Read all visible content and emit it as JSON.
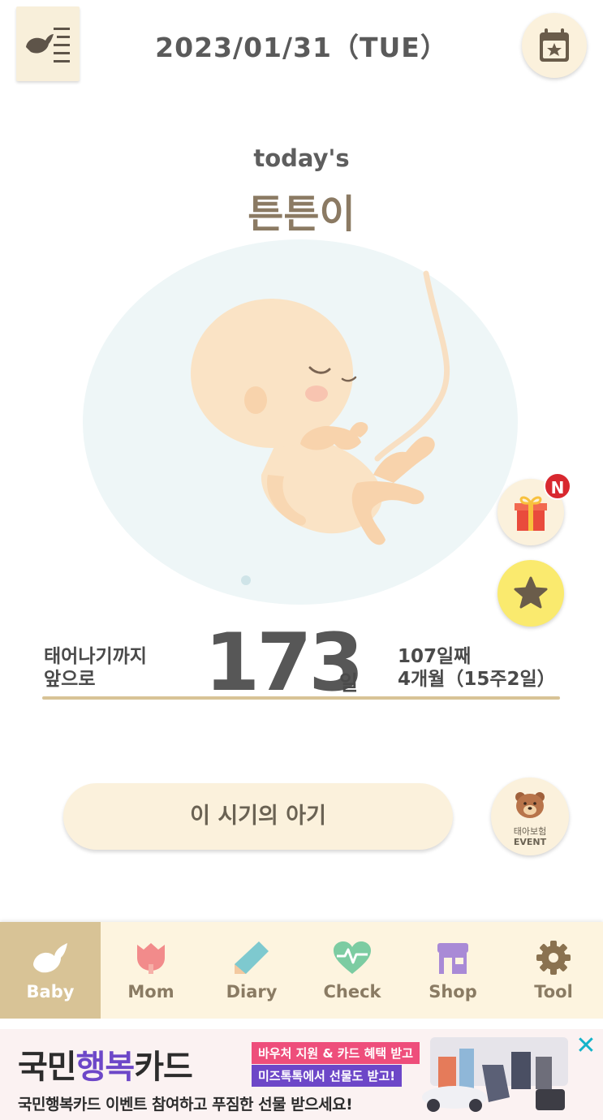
{
  "header": {
    "date": "2023/01/31（TUE）"
  },
  "hero": {
    "subtitle": "today's",
    "baby_name": "튼튼이"
  },
  "countdown": {
    "left_line1": "태어나기까지",
    "left_line2": "앞으로",
    "days": "173",
    "unit": "일",
    "right_line1": "107일째",
    "right_line2": "4개월（15주2일）"
  },
  "badges": {
    "new": "N"
  },
  "buttons": {
    "baby_period": "이 시기의 아기",
    "event_line1": "태아보험",
    "event_line2": "EVENT"
  },
  "nav": {
    "items": [
      {
        "label": "Baby",
        "icon": "baby-bird-icon",
        "active": true
      },
      {
        "label": "Mom",
        "icon": "tulip-icon",
        "active": false
      },
      {
        "label": "Diary",
        "icon": "pencil-icon",
        "active": false
      },
      {
        "label": "Check",
        "icon": "heart-pulse-icon",
        "active": false
      },
      {
        "label": "Shop",
        "icon": "shop-icon",
        "active": false
      },
      {
        "label": "Tool",
        "icon": "gear-icon",
        "active": false
      }
    ]
  },
  "ad": {
    "headline_part1": "국민",
    "headline_part2": "행복",
    "headline_part3": "카드",
    "tag1": "바우처 지원 & 카드 혜택 받고",
    "tag2": "미즈톡톡에서 선물도 받고!",
    "subline": "국민행복카드 이벤트 참여하고 푸짐한 선물 받으세요!",
    "close": "✕"
  },
  "colors": {
    "accent": "#d8c396",
    "cream": "#fbf1dc",
    "name_brown": "#8b7a63",
    "badge_red": "#d8282f",
    "star_yellow": "#faea6e"
  }
}
